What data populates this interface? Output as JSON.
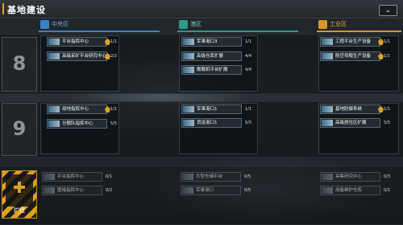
{
  "header": {
    "title": "基地建设",
    "collapse_label": "⌄"
  },
  "columns": [
    {
      "label": "中央区",
      "color": "#3b82c4"
    },
    {
      "label": "港区",
      "color": "#2e9a8a"
    },
    {
      "label": "工业区",
      "color": "#d9952a"
    }
  ],
  "levels": {
    "level8": {
      "number": "8",
      "central": [
        {
          "name": "平台指挥中心",
          "level": "1/1"
        },
        {
          "name": "高级采矿平台研究中心",
          "level": "2/2"
        }
      ],
      "harbor": [
        {
          "name": "军事港口3",
          "level": "1/1"
        },
        {
          "name": "高级仓库扩展",
          "level": "4/4"
        },
        {
          "name": "舰载机平台扩展",
          "level": "4/4"
        }
      ],
      "industrial": [
        {
          "name": "工程平台生产设备",
          "level": "1/1"
        },
        {
          "name": "航空母舰生产设备",
          "level": "1/1"
        }
      ]
    },
    "level9": {
      "number": "9",
      "central": [
        {
          "name": "战地指挥中心",
          "level": "1/1"
        },
        {
          "name": "分舰队指挥中心",
          "level": "5/5"
        }
      ],
      "harbor": [
        {
          "name": "军事港口1",
          "level": "1/1"
        },
        {
          "name": "货运港口1",
          "level": "5/5"
        }
      ],
      "industrial": [
        {
          "name": "基地防御系统",
          "level": "1/1"
        },
        {
          "name": "高级居住区扩展",
          "level": "5/5"
        }
      ]
    },
    "locked": {
      "central": [
        {
          "name": "平台指挥中心",
          "level": "0/1"
        },
        {
          "name": "围堵指挥中心",
          "level": "0/2"
        }
      ],
      "harbor": [
        {
          "name": "大型仓储平台",
          "level": "0/5"
        },
        {
          "name": "军事港口",
          "level": "0/5"
        }
      ],
      "industrial": [
        {
          "name": "采集研究中心",
          "level": "0/3"
        },
        {
          "name": "战备维护仓库",
          "level": "0/1"
        }
      ]
    }
  },
  "expand_button": {
    "label": "扩建"
  },
  "colors": {
    "accent": "#e0a020",
    "central": "#3b82c4",
    "harbor": "#2e9a8a",
    "industrial": "#d9952a"
  }
}
